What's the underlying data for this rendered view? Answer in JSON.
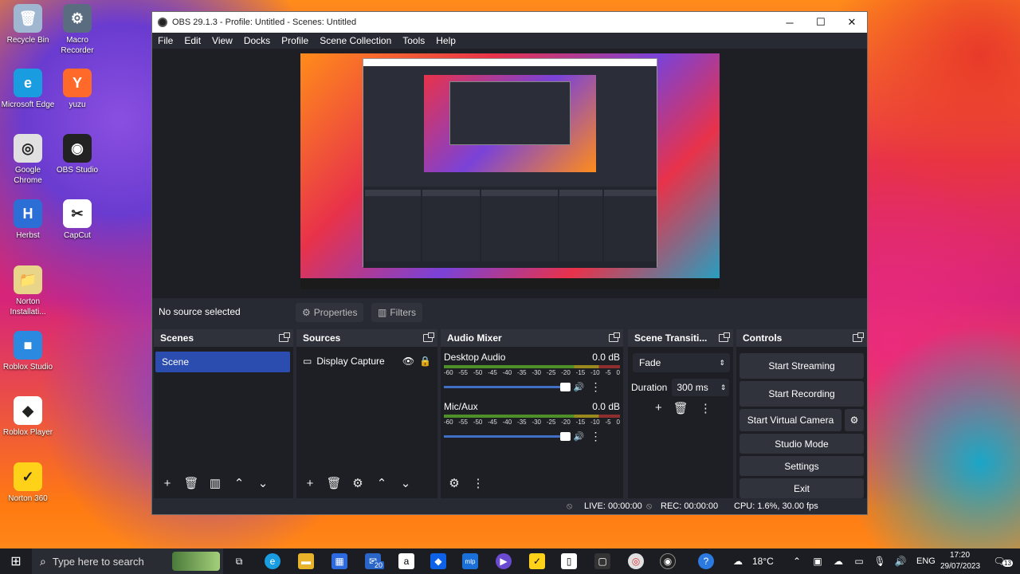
{
  "desktop": {
    "icons": [
      {
        "label": "Recycle Bin",
        "color": "#9fb7d0",
        "glyph": "🗑"
      },
      {
        "label": "Macro Recorder",
        "color": "#5a6d80",
        "glyph": "⚙"
      },
      {
        "label": "Microsoft Edge",
        "color": "#1a9de0",
        "glyph": "e"
      },
      {
        "label": "yuzu",
        "color": "#ff6a2a",
        "glyph": "Y"
      },
      {
        "label": "Google Chrome",
        "color": "#e0e0e0",
        "glyph": "◎"
      },
      {
        "label": "OBS Studio",
        "color": "#222222",
        "glyph": "◉"
      },
      {
        "label": "Herbst",
        "color": "#2b6fd6",
        "glyph": "H"
      },
      {
        "label": "CapCut",
        "color": "#ffffff",
        "glyph": "✂"
      },
      {
        "label": "Norton Installati...",
        "color": "#e8d58a",
        "glyph": "📁"
      },
      {
        "label": "Roblox Studio",
        "color": "#2b8ae0",
        "glyph": "■"
      },
      {
        "label": "Roblox Player",
        "color": "#ffffff",
        "glyph": "◆"
      },
      {
        "label": "Norton 360",
        "color": "#ffd21a",
        "glyph": "✓"
      }
    ]
  },
  "window": {
    "title": "OBS 29.1.3 - Profile: Untitled - Scenes: Untitled",
    "min": "─",
    "max": "☐",
    "close": "✕"
  },
  "menu": [
    "File",
    "Edit",
    "View",
    "Docks",
    "Profile",
    "Scene Collection",
    "Tools",
    "Help"
  ],
  "sourcebar": {
    "no_source": "No source selected",
    "properties": "Properties",
    "filters": "Filters"
  },
  "scenes": {
    "title": "Scenes",
    "items": [
      "Scene"
    ]
  },
  "sources": {
    "title": "Sources",
    "items": [
      {
        "name": "Display Capture"
      }
    ]
  },
  "mixer": {
    "title": "Audio Mixer",
    "scale": [
      "-60",
      "-55",
      "-50",
      "-45",
      "-40",
      "-35",
      "-30",
      "-25",
      "-20",
      "-15",
      "-10",
      "-5",
      "0"
    ],
    "channels": [
      {
        "name": "Desktop Audio",
        "db": "0.0 dB",
        "volume": 0.95
      },
      {
        "name": "Mic/Aux",
        "db": "0.0 dB",
        "volume": 0.95
      }
    ]
  },
  "transitions": {
    "title": "Scene Transiti...",
    "selected": "Fade",
    "duration_label": "Duration",
    "duration_value": "300 ms"
  },
  "controls": {
    "title": "Controls",
    "buttons": [
      "Start Streaming",
      "Start Recording",
      "Start Virtual Camera",
      "Studio Mode",
      "Settings",
      "Exit"
    ]
  },
  "status": {
    "live": "LIVE: 00:00:00",
    "rec": "REC: 00:00:00",
    "cpu": "CPU: 1.6%, 30.00 fps"
  },
  "taskbar": {
    "search_placeholder": "Type here to search",
    "badge": "20",
    "weather": "18°C",
    "lang": "ENG",
    "time": "17:20",
    "date": "29/07/2023",
    "notif": "13"
  }
}
